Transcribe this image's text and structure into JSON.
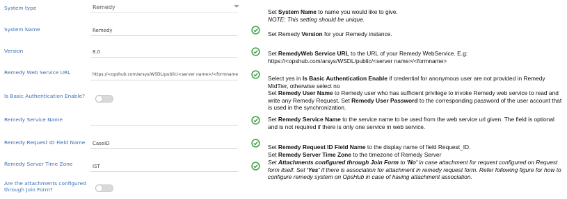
{
  "form": {
    "system_type": {
      "label": "System type",
      "value": "Remedy"
    },
    "system_name": {
      "label": "System Name",
      "value": "Remedy"
    },
    "version": {
      "label": "Version",
      "value": "8.0"
    },
    "web_service_url": {
      "label": "Remedy Web Service URL",
      "value": "https://<opshub.com/arsys/WSDL/public/<server name>/<formname>"
    },
    "basic_auth": {
      "label": "Is Basic Authentication Enable?",
      "value": "off"
    },
    "service_name": {
      "label": "Remedy Service Name",
      "value": ""
    },
    "request_id_field": {
      "label": "Remedy Request ID Field Name",
      "value": "CaseID"
    },
    "server_time_zone": {
      "label": "Remedy Server Time Zone",
      "value": "IST"
    },
    "attachments_join_form": {
      "label": "Are the attachments configured through Join Form?",
      "value": "off"
    }
  },
  "help": {
    "p1": {
      "a": "Set ",
      "b": "System Name",
      "c": " to name you would like to give."
    },
    "p1_note": "NOTE: This setting should be unique.",
    "p2": {
      "a": "Set Remedy ",
      "b": "Version",
      "c": " for your Remedy instance."
    },
    "p3": {
      "a": "Set ",
      "b": "RemedyWeb Service URL",
      "c": " to the URL of your Remedy WebService. E.g:"
    },
    "p3_url": "https://<opshub.com/arsys/WSDL/public/<server name>/<formname>",
    "p4": {
      "a": "Select yes in ",
      "b": "Is Basic Authentication Enable",
      "c": " if credential for anonymous user are not provided in Remedy MidTier, otherwise select no"
    },
    "p5": {
      "a": "Set ",
      "b": "Remedy User Name",
      "c": " to Remedy user who has sufficient privilege to invoke Remedy web service to read and write any Remedy Request. Set ",
      "d": "Remedy User Password",
      "e": " to the corresponding password of the user account that is used in the synchronization."
    },
    "p6": {
      "a": "Set ",
      "b": "Remedy Service Name",
      "c": " to the service name to be used from the web service url given. The field is optional and is not required if there is only one service in web service."
    },
    "p7": {
      "a": "Set ",
      "b": "Remedy Request ID Field Name",
      "c": " to the display name of field Request_ID."
    },
    "p8": {
      "a": "Set ",
      "b": "Remedy Server Time Zone",
      "c": " to the timezone of Remedy Server"
    },
    "p9": {
      "a": "Set ",
      "b": "Attachments configured through Join Form",
      "c": " to ",
      "d": "'No'",
      "e": " in case attachment for request configured on Request form itself. Set ",
      "f": "'Yes'",
      "g": " if there is association for attachment in remedy request form. Refer following figure for how to configure remedy system on OpsHub in case of having attachment association."
    }
  },
  "colors": {
    "label": "#3a6fb0",
    "check": "#43a047"
  },
  "icons": [
    "check-circle-icon",
    "chevron-down-icon",
    "toggle-switch"
  ]
}
